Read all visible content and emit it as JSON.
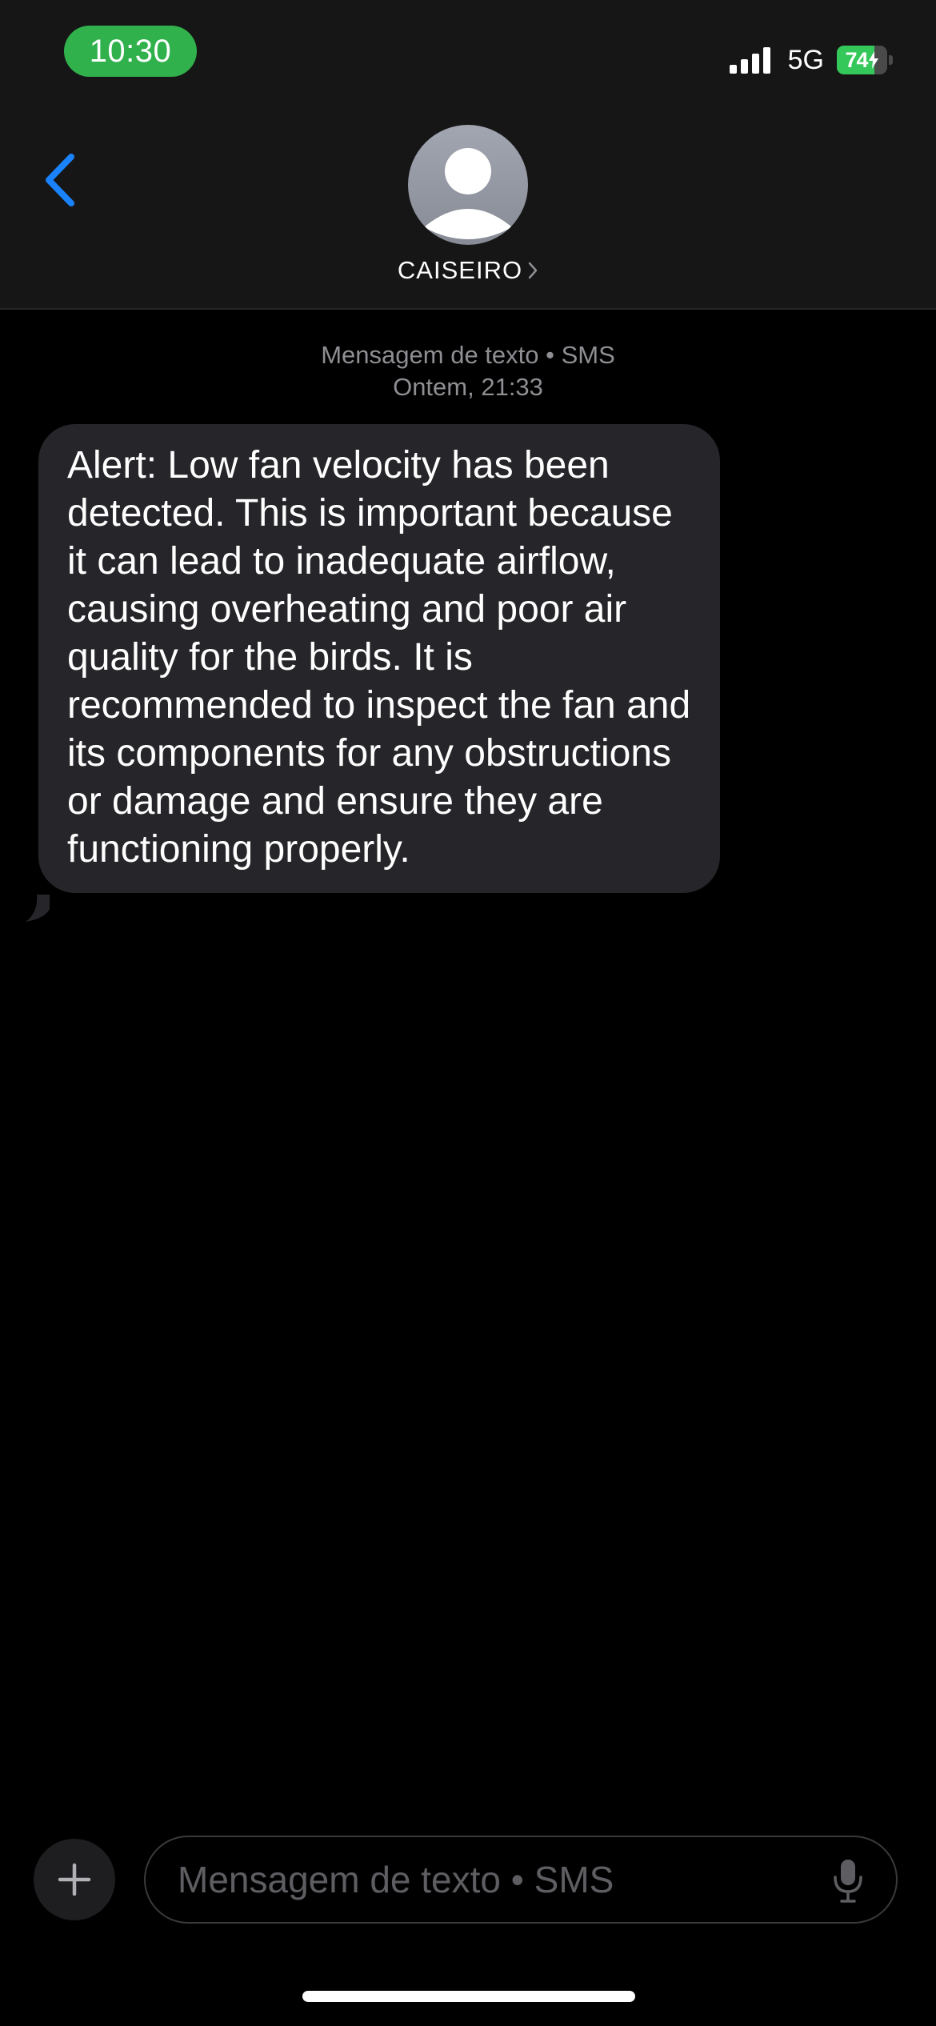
{
  "status_bar": {
    "time": "10:30",
    "network": "5G",
    "battery": "74",
    "battery_level_percent": 74,
    "colors": {
      "time_pill": "#30b14c",
      "battery_fill": "#34c759"
    }
  },
  "header": {
    "contact_name": "CAISEIRO",
    "back_icon": "chevron-left-icon",
    "avatar_icon": "person-silhouette-icon",
    "chevron_icon": "chevron-right-icon",
    "accent_color": "#1a82fb"
  },
  "conversation": {
    "service_label": "Mensagem de texto • SMS",
    "timestamp": "Ontem, 21:33",
    "messages": [
      {
        "direction": "incoming",
        "text": "Alert: Low fan velocity has been detected. This is important because it can lead to inadequate airflow, causing overheating and poor air quality for the birds. It is recommended to inspect the fan and its components for any obstructions or damage and ensure they are functioning properly."
      }
    ]
  },
  "composer": {
    "placeholder": "Mensagem de texto • SMS",
    "value": "",
    "plus_icon": "plus-icon",
    "mic_icon": "microphone-icon"
  }
}
